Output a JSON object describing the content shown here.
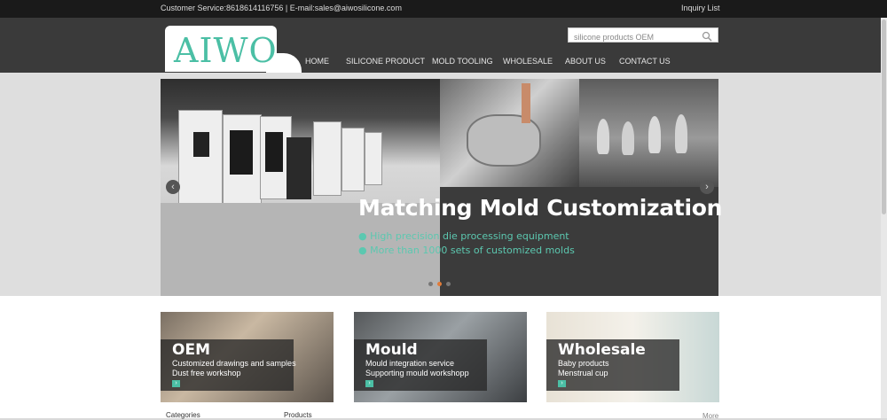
{
  "topbar": {
    "service": "Customer Service:8618614116756  |  E-mail:sales@aiwosilicone.com",
    "inquiry": "Inquiry List"
  },
  "logo": {
    "text": "AIWO",
    "color": "#4bbfa5"
  },
  "search": {
    "value": "silicone products OEM",
    "icon": "search-icon"
  },
  "nav": [
    "HOME",
    "SILICONE PRODUCT",
    "MOLD TOOLING",
    "WHOLESALE",
    "ABOUT US",
    "CONTACT US"
  ],
  "banner": {
    "headline": "Matching Mold Customization",
    "bullets": [
      "High precision die processing equipment",
      "More than 1000 sets of customized molds"
    ],
    "prev": "‹",
    "next": "›",
    "slides": 3,
    "active_slide": 2
  },
  "cards": [
    {
      "title": "OEM",
      "line1": "Customized drawings and samples",
      "line2": "Dust free workshop",
      "go": "›"
    },
    {
      "title": "Mould",
      "line1": "Mould integration service",
      "line2": "Supporting mould workshopp",
      "go": "›"
    },
    {
      "title": "Wholesale",
      "line1": "Baby products",
      "line2": "Menstrual cup",
      "go": "›"
    }
  ],
  "footer_row": {
    "categories": "Categories",
    "products": "Products",
    "more": "More"
  },
  "colors": {
    "accent": "#4bbfa5",
    "header": "#3a3a3a",
    "topbar": "#1a1a1a"
  }
}
